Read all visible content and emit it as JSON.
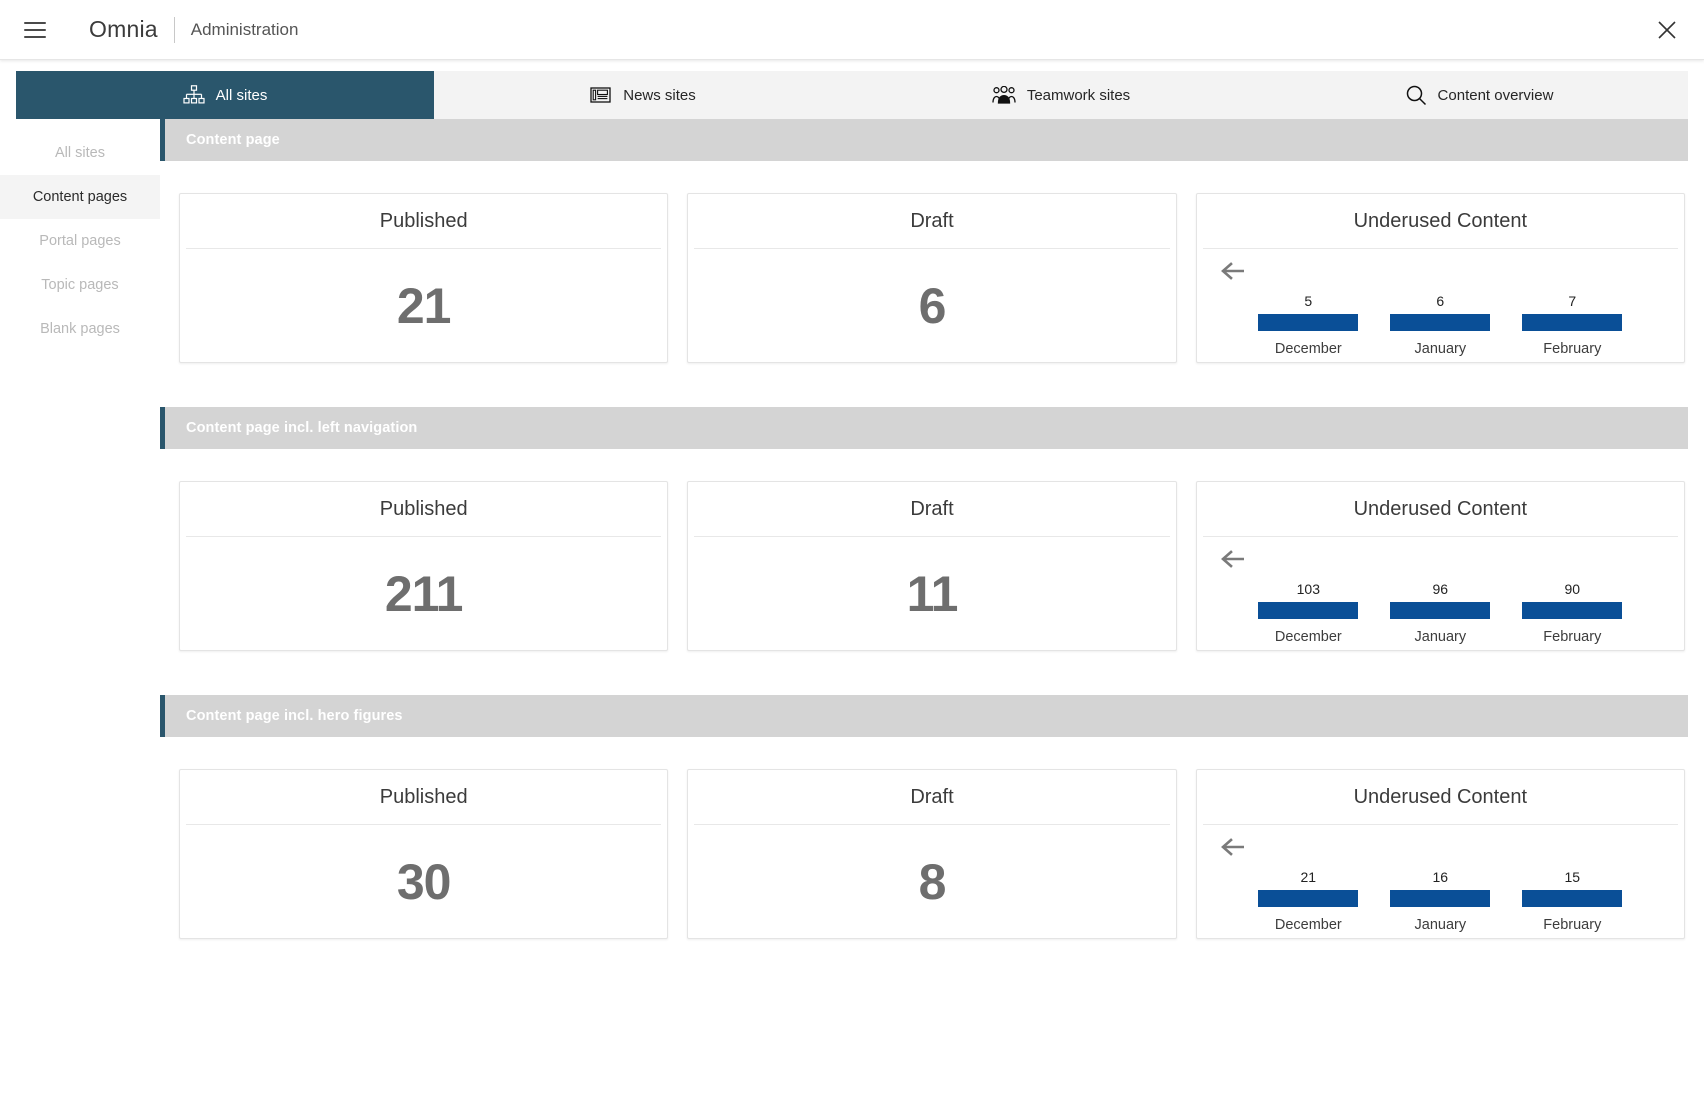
{
  "topbar": {
    "menu_icon": "hamburger-menu-icon",
    "brand": "Omnia",
    "subtitle": "Administration",
    "close_icon": "close-icon"
  },
  "tabs": [
    {
      "label": "All sites",
      "icon": "sitemap-icon",
      "active": true
    },
    {
      "label": "News sites",
      "icon": "newspaper-icon",
      "active": false
    },
    {
      "label": "Teamwork sites",
      "icon": "people-group-icon",
      "active": false
    },
    {
      "label": "Content overview",
      "icon": "search-icon",
      "active": false
    }
  ],
  "sidebar": {
    "items": [
      {
        "label": "All sites",
        "active": false
      },
      {
        "label": "Content pages",
        "active": true
      },
      {
        "label": "Portal pages",
        "active": false
      },
      {
        "label": "Topic pages",
        "active": false
      },
      {
        "label": "Blank pages",
        "active": false
      }
    ]
  },
  "colors": {
    "accent_dark": "#2a566c",
    "bar_blue": "#0a4f97",
    "section_header_bg": "#d4d4d4",
    "number_gray": "#6e6e6e"
  },
  "labels": {
    "published": "Published",
    "draft": "Draft",
    "underused": "Underused Content",
    "back_arrow": "back-arrow-icon"
  },
  "sections": [
    {
      "title": "Content page",
      "published": "21",
      "draft": "6",
      "chart_title": "Underused Content"
    },
    {
      "title": "Content page incl. left navigation",
      "published": "211",
      "draft": "11",
      "chart_title": "Underused Content"
    },
    {
      "title": "Content page incl. hero figures",
      "published": "30",
      "draft": "8",
      "chart_title": "Underused Content"
    }
  ],
  "chart_data": [
    {
      "type": "bar",
      "title": "Underused Content",
      "categories": [
        "December",
        "January",
        "February"
      ],
      "values": [
        5,
        6,
        7
      ],
      "xlabel": "",
      "ylabel": "",
      "ylim": [
        0,
        7
      ],
      "grid": false,
      "legend": "none",
      "series": [
        {
          "name": "Underused Content",
          "values": [
            5,
            6,
            7
          ]
        }
      ],
      "section": "Content page"
    },
    {
      "type": "bar",
      "title": "Underused Content",
      "categories": [
        "December",
        "January",
        "February"
      ],
      "values": [
        103,
        96,
        90
      ],
      "xlabel": "",
      "ylabel": "",
      "ylim": [
        0,
        103
      ],
      "grid": false,
      "legend": "none",
      "series": [
        {
          "name": "Underused Content",
          "values": [
            103,
            96,
            90
          ]
        }
      ],
      "section": "Content page incl. left navigation"
    },
    {
      "type": "bar",
      "title": "Underused Content",
      "categories": [
        "December",
        "January",
        "February"
      ],
      "values": [
        21,
        16,
        15
      ],
      "xlabel": "",
      "ylabel": "",
      "ylim": [
        0,
        21
      ],
      "grid": false,
      "legend": "none",
      "series": [
        {
          "name": "Underused Content",
          "values": [
            21,
            16,
            15
          ]
        }
      ],
      "section": "Content page incl. hero figures"
    }
  ]
}
